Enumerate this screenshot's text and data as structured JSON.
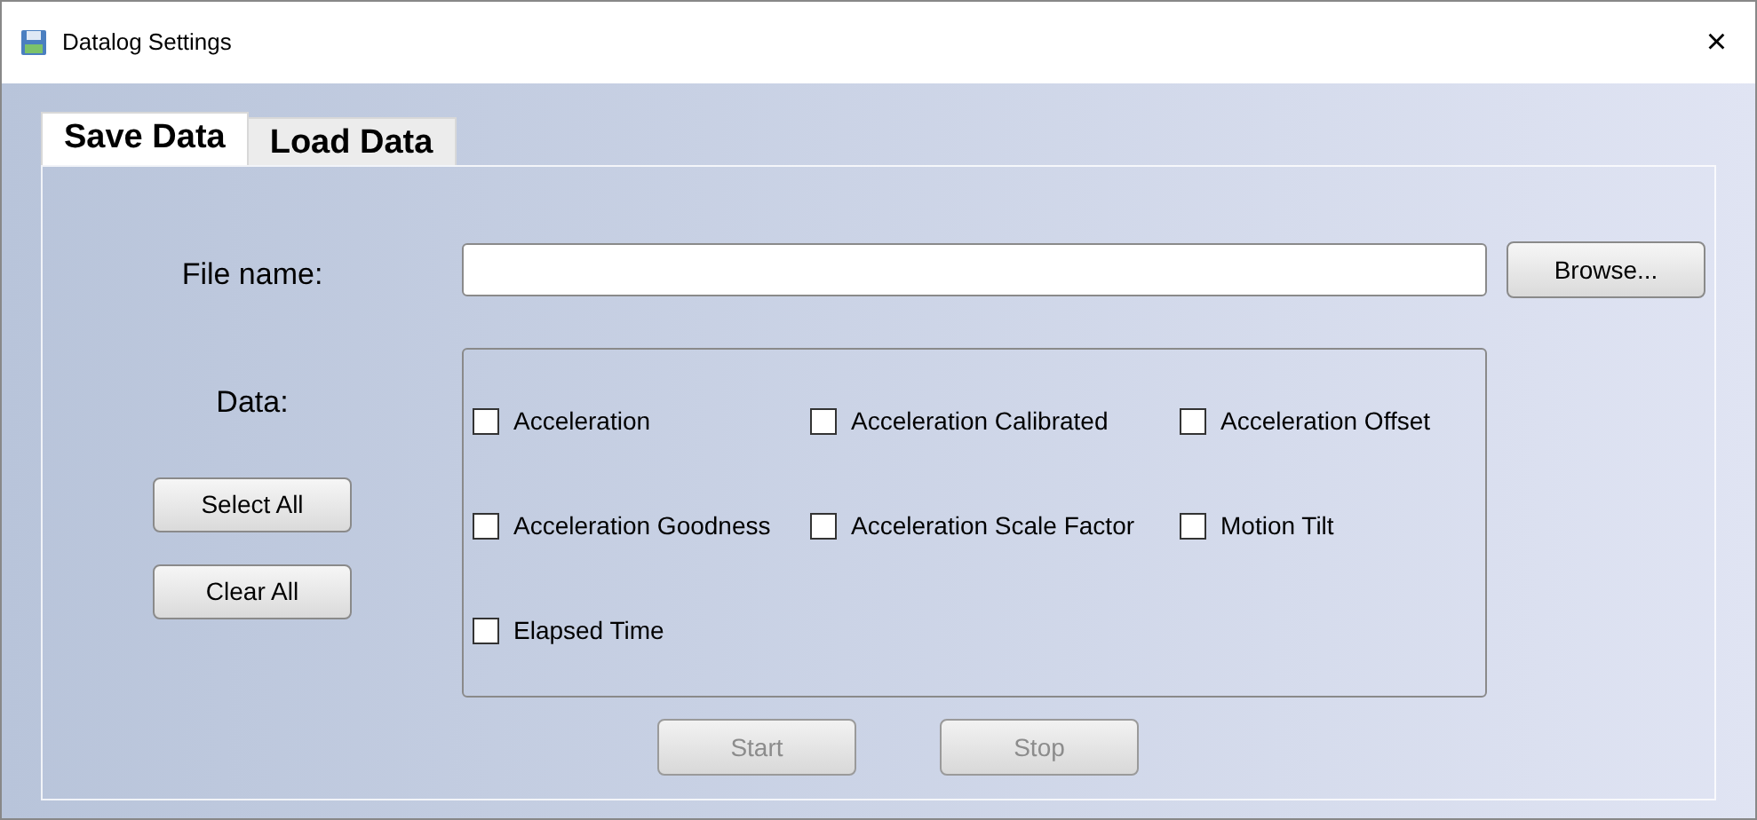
{
  "window": {
    "title": "Datalog Settings",
    "close": "×"
  },
  "tabs": [
    {
      "label": "Save Data",
      "selected": true
    },
    {
      "label": "Load Data",
      "selected": false
    }
  ],
  "file_name": {
    "label": "File name:",
    "browse": "Browse..."
  },
  "data": {
    "label": "Data:",
    "select_all": "Select All",
    "clear_all": "Clear All",
    "options": [
      {
        "label": "Acceleration",
        "checked": false
      },
      {
        "label": "Acceleration Calibrated",
        "checked": false
      },
      {
        "label": "Acceleration Offset",
        "checked": false
      },
      {
        "label": "Acceleration Goodness",
        "checked": false
      },
      {
        "label": "Acceleration Scale Factor",
        "checked": false
      },
      {
        "label": "Motion Tilt",
        "checked": false
      },
      {
        "label": "Elapsed Time",
        "checked": false
      }
    ]
  },
  "actions": [
    {
      "label": "Start",
      "disabled": true
    },
    {
      "label": "Stop",
      "disabled": true
    }
  ]
}
